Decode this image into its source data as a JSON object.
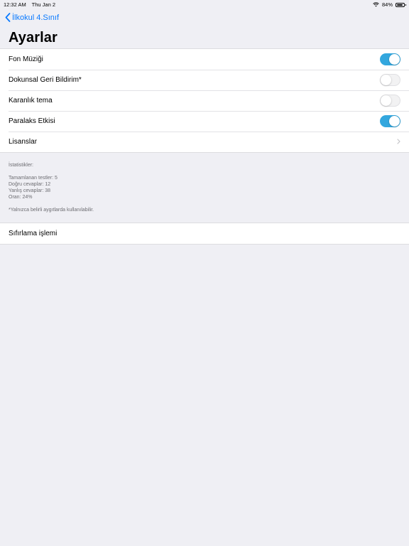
{
  "status_bar": {
    "time": "12:32 AM",
    "date": "Thu Jan 2",
    "battery": "84%",
    "battery_level": 0.84
  },
  "nav": {
    "back_label": "İlkokul 4.Sınıf"
  },
  "title": "Ayarlar",
  "settings": [
    {
      "label": "Fon Müziği",
      "on": true
    },
    {
      "label": "Dokunsal Geri Bildirim*",
      "on": false
    },
    {
      "label": "Karanlık tema",
      "on": false
    },
    {
      "label": "Paralaks Etkisi",
      "on": true
    }
  ],
  "licenses_label": "Lisanslar",
  "stats": {
    "heading": "İstatistikler:",
    "completed": "Tamamlanan testler: 5",
    "correct": "Doğru cevaplar: 12",
    "wrong": "Yanlış cevaplar: 38",
    "ratio": "Oran: 24%"
  },
  "footnote": "*Yalnızca belirli aygıtlarda kullanılabilir.",
  "reset_label": "Sıfırlama işlemi",
  "colors": {
    "accent": "#0a7aff",
    "toggle_on": "#33a7de",
    "background": "#efeff4"
  }
}
